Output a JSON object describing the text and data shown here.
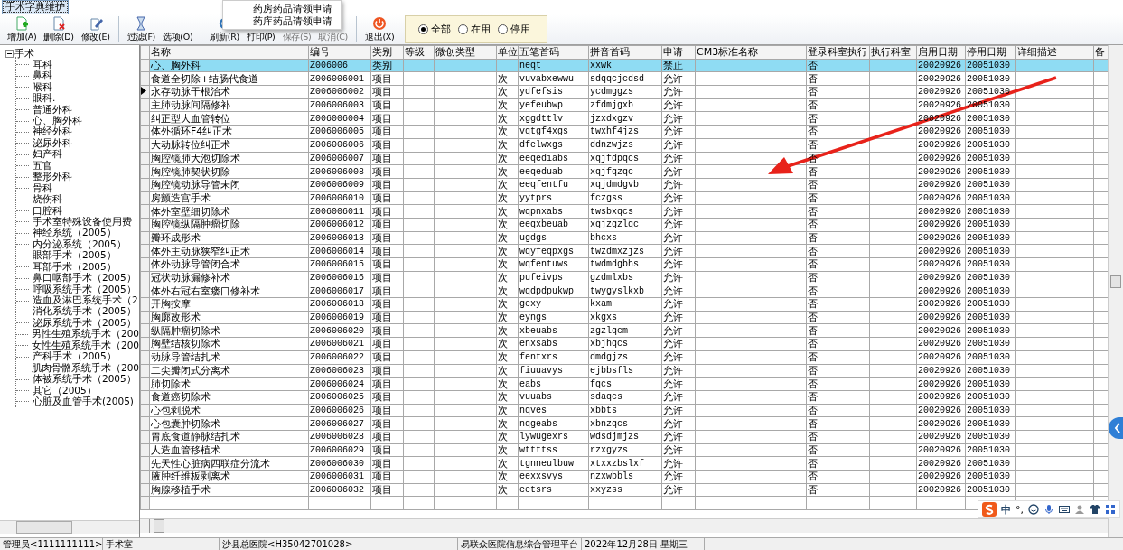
{
  "tabs": [
    {
      "label": "手术字典维护",
      "selected": true
    }
  ],
  "toolbar": {
    "buttons": [
      {
        "label": "增加(A)",
        "kind": "add",
        "disabled": false
      },
      {
        "label": "删除(D)",
        "kind": "delete",
        "disabled": false
      },
      {
        "label": "修改(E)",
        "kind": "edit",
        "disabled": false
      },
      {
        "label": "过滤(F)",
        "kind": "filter",
        "disabled": false
      },
      {
        "label": "选项(O)",
        "kind": "options",
        "disabled": false
      },
      {
        "label": "刷新(R)",
        "kind": "refresh",
        "disabled": false
      },
      {
        "label": "打印(P)",
        "kind": "print",
        "disabled": false
      },
      {
        "label": "保存(S)",
        "kind": "save",
        "disabled": true
      },
      {
        "label": "取消(C)",
        "kind": "cancel",
        "disabled": true
      },
      {
        "label": "退出(X)",
        "kind": "exit",
        "disabled": false
      }
    ],
    "filter": [
      {
        "label": "全部",
        "selected": true
      },
      {
        "label": "在用",
        "selected": false
      },
      {
        "label": "停用",
        "selected": false
      }
    ]
  },
  "popup_menu": {
    "items": [
      "药房药品请领申请",
      "药库药品请领申请"
    ]
  },
  "tree": {
    "label": "手术",
    "expanded": true,
    "children": [
      {
        "label": "耳科"
      },
      {
        "label": "鼻科"
      },
      {
        "label": "喉科"
      },
      {
        "label": "眼科."
      },
      {
        "label": "普通外科"
      },
      {
        "label": "心、胸外科"
      },
      {
        "label": "神经外科"
      },
      {
        "label": "泌尿外科"
      },
      {
        "label": "妇产科"
      },
      {
        "label": "五官"
      },
      {
        "label": "整形外科"
      },
      {
        "label": "骨科"
      },
      {
        "label": "烧伤科"
      },
      {
        "label": "口腔科"
      },
      {
        "label": "手术室特殊设备使用费"
      },
      {
        "label": "神经系统（2005）"
      },
      {
        "label": "内分泌系统（2005）"
      },
      {
        "label": "眼部手术（2005）"
      },
      {
        "label": "耳部手术（2005）"
      },
      {
        "label": "鼻口咽部手术（2005）"
      },
      {
        "label": "呼吸系统手术（2005）"
      },
      {
        "label": "造血及淋巴系统手术（2"
      },
      {
        "label": "消化系统手术（2005）"
      },
      {
        "label": "泌尿系统手术（2005）"
      },
      {
        "label": "男性生殖系统手术（200"
      },
      {
        "label": "女性生殖系统手术（200"
      },
      {
        "label": "产科手术（2005）"
      },
      {
        "label": "肌肉骨骼系统手术（200"
      },
      {
        "label": "体被系统手术（2005）"
      },
      {
        "label": "其它（2005）"
      },
      {
        "label": "心脏及血管手术(2005)"
      }
    ]
  },
  "table": {
    "columns": [
      "名称",
      "编号",
      "类别",
      "等级",
      "微创类型",
      "单位",
      "五笔首码",
      "拼音首码",
      "申请",
      "CM3标准名称",
      "登录科室执行",
      "执行科室",
      "启用日期",
      "停用日期",
      "详细描述",
      "备"
    ],
    "rows": [
      {
        "name": "心、胸外科",
        "code": "Z006006",
        "category": "类别",
        "wubi": "neqt",
        "pinyin": "xxwk",
        "apply": "禁止",
        "login_exec": "否",
        "start": "20020926",
        "end": "20051030",
        "selected": true,
        "current": false
      },
      {
        "name": "食道全切除+结肠代食道",
        "code": "Z006006001",
        "category": "项目",
        "unit": "次",
        "wubi": "vuvabxewwu",
        "pinyin": "sdqqcjcdsd",
        "apply": "允许",
        "login_exec": "否",
        "start": "20020926",
        "end": "20051030",
        "selected": false,
        "current": false
      },
      {
        "name": "永存动脉干根治术",
        "code": "Z006006002",
        "category": "项目",
        "unit": "次",
        "wubi": "ydfefsis",
        "pinyin": "ycdmggzs",
        "apply": "允许",
        "login_exec": "否",
        "start": "20020926",
        "end": "20051030",
        "selected": false,
        "current": true
      },
      {
        "name": "主肺动脉间隔修补",
        "code": "Z006006003",
        "category": "项目",
        "unit": "次",
        "wubi": "yefeubwp",
        "pinyin": "zfdmjgxb",
        "apply": "允许",
        "login_exec": "否",
        "start": "20020926",
        "end": "20051030",
        "selected": false,
        "current": false
      },
      {
        "name": "纠正型大血管转位",
        "code": "Z006006004",
        "category": "项目",
        "unit": "次",
        "wubi": "xggdttlv",
        "pinyin": "jzxdxgzv",
        "apply": "允许",
        "login_exec": "否",
        "start": "20020926",
        "end": "20051030",
        "selected": false,
        "current": false
      },
      {
        "name": "体外循环F4纠正术",
        "code": "Z006006005",
        "category": "项目",
        "unit": "次",
        "wubi": "vqtgf4xgs",
        "pinyin": "twxhf4jzs",
        "apply": "允许",
        "login_exec": "否",
        "start": "20020926",
        "end": "20051030",
        "selected": false,
        "current": false
      },
      {
        "name": "大动脉转位纠正术",
        "code": "Z006006006",
        "category": "项目",
        "unit": "次",
        "wubi": "dfelwxgs",
        "pinyin": "ddnzwjzs",
        "apply": "允许",
        "login_exec": "否",
        "start": "20020926",
        "end": "20051030",
        "selected": false,
        "current": false
      },
      {
        "name": "胸腔镜肺大泡切除术",
        "code": "Z006006007",
        "category": "项目",
        "unit": "次",
        "wubi": "eeqediabs",
        "pinyin": "xqjfdpqcs",
        "apply": "允许",
        "login_exec": "否",
        "start": "20020926",
        "end": "20051030",
        "selected": false,
        "current": false
      },
      {
        "name": "胸腔镜肺契状切除",
        "code": "Z006006008",
        "category": "项目",
        "unit": "次",
        "wubi": "eeqeduab",
        "pinyin": "xqjfqzqc",
        "apply": "允许",
        "login_exec": "否",
        "start": "20020926",
        "end": "20051030",
        "selected": false,
        "current": false
      },
      {
        "name": "胸腔镜动脉导管未闭",
        "code": "Z006006009",
        "category": "项目",
        "unit": "次",
        "wubi": "eeqfentfu",
        "pinyin": "xqjdmdgvb",
        "apply": "允许",
        "login_exec": "否",
        "start": "20020926",
        "end": "20051030",
        "selected": false,
        "current": false
      },
      {
        "name": "房颤造宫手术",
        "code": "Z006006010",
        "category": "项目",
        "unit": "次",
        "wubi": "yytprs",
        "pinyin": "fczgss",
        "apply": "允许",
        "login_exec": "否",
        "start": "20020926",
        "end": "20051030",
        "selected": false,
        "current": false
      },
      {
        "name": "体外室壁细切除术",
        "code": "Z006006011",
        "category": "项目",
        "unit": "次",
        "wubi": "wqpnxabs",
        "pinyin": "twsbxqcs",
        "apply": "允许",
        "login_exec": "否",
        "start": "20020926",
        "end": "20051030",
        "selected": false,
        "current": false
      },
      {
        "name": "胸腔镜纵隔肿瘤切除",
        "code": "Z006006012",
        "category": "项目",
        "unit": "次",
        "wubi": "eeqxbeuab",
        "pinyin": "xqjzgzlqc",
        "apply": "允许",
        "login_exec": "否",
        "start": "20020926",
        "end": "20051030",
        "selected": false,
        "current": false
      },
      {
        "name": "瓣环成形术",
        "code": "Z006006013",
        "category": "项目",
        "unit": "次",
        "wubi": "ugdgs",
        "pinyin": "bhcxs",
        "apply": "允许",
        "login_exec": "否",
        "start": "20020926",
        "end": "20051030",
        "selected": false,
        "current": false
      },
      {
        "name": "体外主动脉狭窄纠正术",
        "code": "Z006006014",
        "category": "项目",
        "unit": "次",
        "wubi": "wqyfeqpxgs",
        "pinyin": "twzdmxzjzs",
        "apply": "允许",
        "login_exec": "否",
        "start": "20020926",
        "end": "20051030",
        "selected": false,
        "current": false
      },
      {
        "name": "体外动脉导管闭合术",
        "code": "Z006006015",
        "category": "项目",
        "unit": "次",
        "wubi": "wqfentuws",
        "pinyin": "twdmdgbhs",
        "apply": "允许",
        "login_exec": "否",
        "start": "20020926",
        "end": "20051030",
        "selected": false,
        "current": false
      },
      {
        "name": "冠状动脉漏修补术",
        "code": "Z006006016",
        "category": "项目",
        "unit": "次",
        "wubi": "pufeivps",
        "pinyin": "gzdmlxbs",
        "apply": "允许",
        "login_exec": "否",
        "start": "20020926",
        "end": "20051030",
        "selected": false,
        "current": false
      },
      {
        "name": "体外右冠右室瘘口修补术",
        "code": "Z006006017",
        "category": "项目",
        "unit": "次",
        "wubi": "wqdpdpukwp",
        "pinyin": "twygyslkxb",
        "apply": "允许",
        "login_exec": "否",
        "start": "20020926",
        "end": "20051030",
        "selected": false,
        "current": false
      },
      {
        "name": "开胸按摩",
        "code": "Z006006018",
        "category": "项目",
        "unit": "次",
        "wubi": "gexy",
        "pinyin": "kxam",
        "apply": "允许",
        "login_exec": "否",
        "start": "20020926",
        "end": "20051030",
        "selected": false,
        "current": false
      },
      {
        "name": "胸廓改形术",
        "code": "Z006006019",
        "category": "项目",
        "unit": "次",
        "wubi": "eyngs",
        "pinyin": "xkgxs",
        "apply": "允许",
        "login_exec": "否",
        "start": "20020926",
        "end": "20051030",
        "selected": false,
        "current": false
      },
      {
        "name": "纵隔肿瘤切除术",
        "code": "Z006006020",
        "category": "项目",
        "unit": "次",
        "wubi": "xbeuabs",
        "pinyin": "zgzlqcm",
        "apply": "允许",
        "login_exec": "否",
        "start": "20020926",
        "end": "20051030",
        "selected": false,
        "current": false
      },
      {
        "name": "胸壁结核切除术",
        "code": "Z006006021",
        "category": "项目",
        "unit": "次",
        "wubi": "enxsabs",
        "pinyin": "xbjhqcs",
        "apply": "允许",
        "login_exec": "否",
        "start": "20020926",
        "end": "20051030",
        "selected": false,
        "current": false
      },
      {
        "name": "动脉导管结扎术",
        "code": "Z006006022",
        "category": "项目",
        "unit": "次",
        "wubi": "fentxrs",
        "pinyin": "dmdgjzs",
        "apply": "允许",
        "login_exec": "否",
        "start": "20020926",
        "end": "20051030",
        "selected": false,
        "current": false
      },
      {
        "name": "二尖瓣闭式分离术",
        "code": "Z006006023",
        "category": "项目",
        "unit": "次",
        "wubi": "fiuuavys",
        "pinyin": "ejbbsfls",
        "apply": "允许",
        "login_exec": "否",
        "start": "20020926",
        "end": "20051030",
        "selected": false,
        "current": false
      },
      {
        "name": "肺切除术",
        "code": "Z006006024",
        "category": "项目",
        "unit": "次",
        "wubi": "eabs",
        "pinyin": "fqcs",
        "apply": "允许",
        "login_exec": "否",
        "start": "20020926",
        "end": "20051030",
        "selected": false,
        "current": false
      },
      {
        "name": "食道癌切除术",
        "code": "Z006006025",
        "category": "项目",
        "unit": "次",
        "wubi": "vuuabs",
        "pinyin": "sdaqcs",
        "apply": "允许",
        "login_exec": "否",
        "start": "20020926",
        "end": "20051030",
        "selected": false,
        "current": false
      },
      {
        "name": "心包剥脱术",
        "code": "Z006006026",
        "category": "项目",
        "unit": "次",
        "wubi": "nqves",
        "pinyin": "xbbts",
        "apply": "允许",
        "login_exec": "否",
        "start": "20020926",
        "end": "20051030",
        "selected": false,
        "current": false
      },
      {
        "name": "心包囊肿切除术",
        "code": "Z006006027",
        "category": "项目",
        "unit": "次",
        "wubi": "nqgeabs",
        "pinyin": "xbnzqcs",
        "apply": "允许",
        "login_exec": "否",
        "start": "20020926",
        "end": "20051030",
        "selected": false,
        "current": false
      },
      {
        "name": "胃底食道静脉结扎术",
        "code": "Z006006028",
        "category": "项目",
        "unit": "次",
        "wubi": "lywugexrs",
        "pinyin": "wdsdjmjzs",
        "apply": "允许",
        "login_exec": "否",
        "start": "20020926",
        "end": "20051030",
        "selected": false,
        "current": false
      },
      {
        "name": "人造血管移植术",
        "code": "Z006006029",
        "category": "项目",
        "unit": "次",
        "wubi": "wttttss",
        "pinyin": "rzxgyzs",
        "apply": "允许",
        "login_exec": "否",
        "start": "20020926",
        "end": "20051030",
        "selected": false,
        "current": false
      },
      {
        "name": "先天性心脏病四联症分流术",
        "code": "Z006006030",
        "category": "项目",
        "unit": "次",
        "wubi": "tgnneulbuw",
        "pinyin": "xtxxzbslxf",
        "apply": "允许",
        "login_exec": "否",
        "start": "20020926",
        "end": "20051030",
        "selected": false,
        "current": false
      },
      {
        "name": "腋肿纤维板剥离术",
        "code": "Z006006031",
        "category": "项目",
        "unit": "次",
        "wubi": "eexxsvys",
        "pinyin": "nzxwbbls",
        "apply": "允许",
        "login_exec": "否",
        "start": "20020926",
        "end": "20051030",
        "selected": false,
        "current": false
      },
      {
        "name": "胸腺移植手术",
        "code": "Z006006032",
        "category": "项目",
        "unit": "次",
        "wubi": "eetsrs",
        "pinyin": "xxyzss",
        "apply": "允许",
        "login_exec": "否",
        "start": "20020926",
        "end": "20051030",
        "selected": false,
        "current": false
      }
    ]
  },
  "ime_bar": {
    "language": "中",
    "punctuation": "°,"
  },
  "status_bar": [
    "管理员<1111111111>",
    "手术室",
    "沙县总医院<H35042701028>",
    "易联众医院信息综合管理平台",
    "2022年12月28日 星期三"
  ]
}
